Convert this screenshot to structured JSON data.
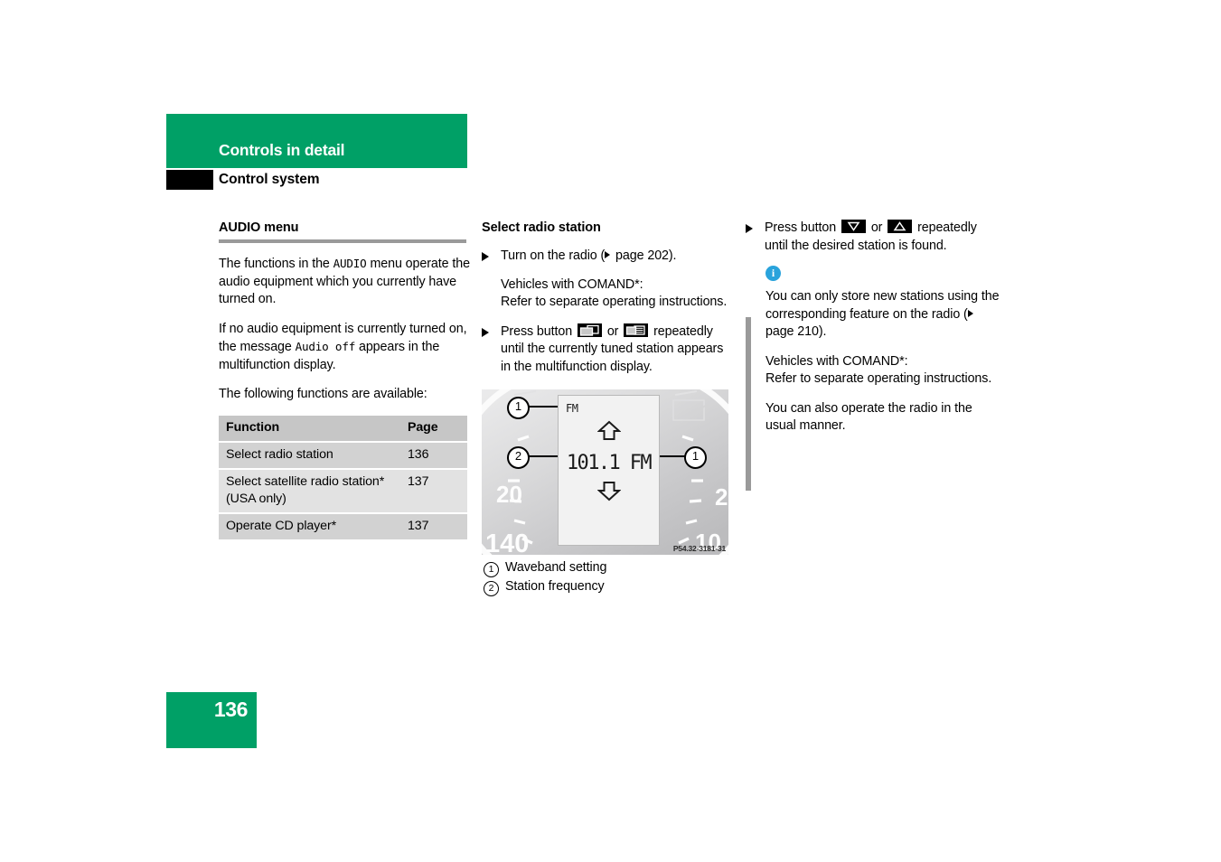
{
  "header": {
    "chapter_title": "Controls in detail",
    "section_title": "Control system",
    "green": "#00A066"
  },
  "left_column": {
    "heading": "AUDIO menu",
    "paragraph_1_a": "The functions in the ",
    "paragraph_1_mono": "AUDIO",
    "paragraph_1_b": " menu operate the audio equipment which you currently have turned on.",
    "paragraph_2_a": "If no audio equipment is currently turned on, the message ",
    "paragraph_2_mono": "Audio off",
    "paragraph_2_b": " appears in the multifunction display.",
    "paragraph_3": "The following functions are available:",
    "table": {
      "headers": [
        "Function",
        "Page"
      ],
      "rows": [
        {
          "function": "Select radio station",
          "page": "136"
        },
        {
          "function": "Select satellite radio station* (USA only)",
          "page": "137"
        },
        {
          "function": "Operate CD player*",
          "page": "137"
        }
      ]
    }
  },
  "middle_column": {
    "heading": "Select radio station",
    "step_1_a": "Turn on the radio (",
    "step_1_b": " page 202).",
    "note_1_line_1": "Vehicles with COMAND*:",
    "note_1_line_2": "Refer to separate operating instructions.",
    "step_2_a": "Press button ",
    "step_2_b": " or ",
    "step_2_c": " repeatedly until the currently tuned station appears in the multifunction display.",
    "figure": {
      "lcd_waveband": "FM",
      "lcd_frequency": "101.1 FM",
      "image_code": "P54.32-3181-31",
      "gauge_label_left_upper": "20",
      "gauge_label_left_lower": "140",
      "gauge_label_right_upper": "2",
      "gauge_label_right_lower": "10",
      "callout_top": "1",
      "callout_left": "2",
      "callout_right": "1"
    },
    "legend": [
      {
        "num": "1",
        "label": "Waveband setting"
      },
      {
        "num": "2",
        "label": "Station frequency"
      }
    ]
  },
  "right_column": {
    "step_1_a": "Press button ",
    "step_1_b": " or ",
    "step_1_c": " repeatedly until the desired station is found.",
    "note": {
      "icon": "info-icon",
      "paragraph_1_a": "You can only store new stations using the corresponding feature on the radio (",
      "paragraph_1_b": " page 210).",
      "paragraph_2_line_1": "Vehicles with COMAND*:",
      "paragraph_2_line_2": "Refer to separate operating instructions.",
      "paragraph_3": "You can also operate the radio in the usual manner."
    }
  },
  "footer": {
    "page_number": "136"
  }
}
